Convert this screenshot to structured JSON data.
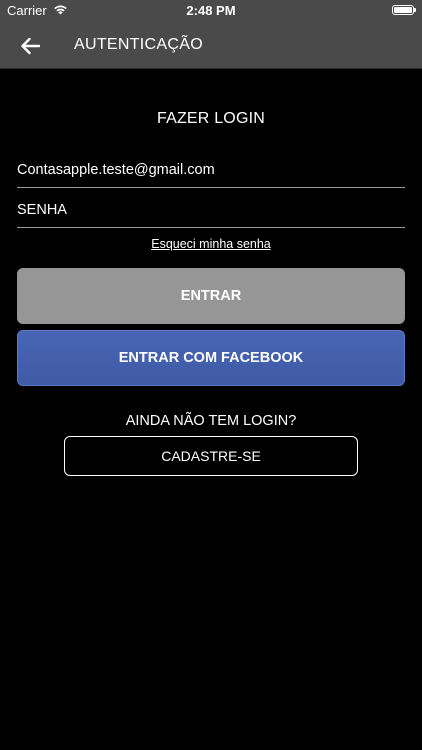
{
  "status_bar": {
    "carrier": "Carrier",
    "time": "2:48 PM",
    "wifi_icon": "wifi-icon",
    "battery_icon": "battery-icon"
  },
  "nav": {
    "back_icon": "arrow-left-icon",
    "title": "AUTENTICAÇÃO",
    "background": "#4a4a4a"
  },
  "login": {
    "title": "FAZER LOGIN",
    "email_value": "Contasapple.teste@gmail.com",
    "email_placeholder": "",
    "password_value": "",
    "password_placeholder": "SENHA",
    "forgot_password": "Esqueci minha senha",
    "login_button": "ENTRAR",
    "facebook_button": "ENTRAR COM FACEBOOK"
  },
  "register": {
    "prompt": "AINDA NÃO TEM LOGIN?",
    "button": "CADASTRE-SE"
  },
  "colors": {
    "background": "#000000",
    "login_button": "#969696",
    "facebook_button": "#4361ad",
    "text": "#ffffff"
  }
}
